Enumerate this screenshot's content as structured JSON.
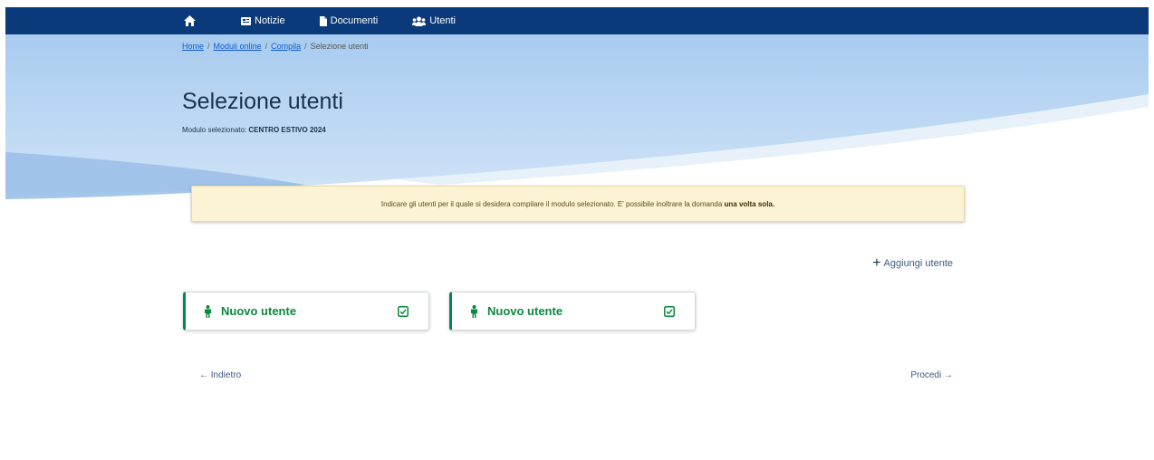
{
  "colors": {
    "topbar": "#0b3a7a",
    "accent_green": "#0a8a3c",
    "alert_bg": "#fbf3d4",
    "link": "#0b5bd6"
  },
  "nav": {
    "home_icon": "home-icon",
    "items": [
      {
        "icon": "newspaper-icon",
        "label": "Notizie"
      },
      {
        "icon": "document-icon",
        "label": "Documenti"
      },
      {
        "icon": "users-icon",
        "label": "Utenti"
      }
    ]
  },
  "breadcrumb": {
    "items": [
      "Home",
      "Moduli online",
      "Compila"
    ],
    "current": "Selezione utenti"
  },
  "page": {
    "title": "Selezione utenti",
    "subtitle_prefix": "Modulo selezionato:",
    "subtitle_value": "CENTRO ESTIVO 2024"
  },
  "alert": {
    "text": "Indicare gli utenti per il quale si desidera compilare il modulo selezionato. E' possibile inoltrare la domanda ",
    "emphasis": "una volta sola."
  },
  "actions": {
    "add_user": "Aggiungi utente",
    "back": "← Indietro",
    "proceed": "Procedi →"
  },
  "users": [
    {
      "label": "Nuovo utente",
      "icon": "person-icon",
      "status_icon": "checkbox-checked-icon"
    },
    {
      "label": "Nuovo utente",
      "icon": "person-icon",
      "status_icon": "checkbox-checked-icon"
    }
  ]
}
